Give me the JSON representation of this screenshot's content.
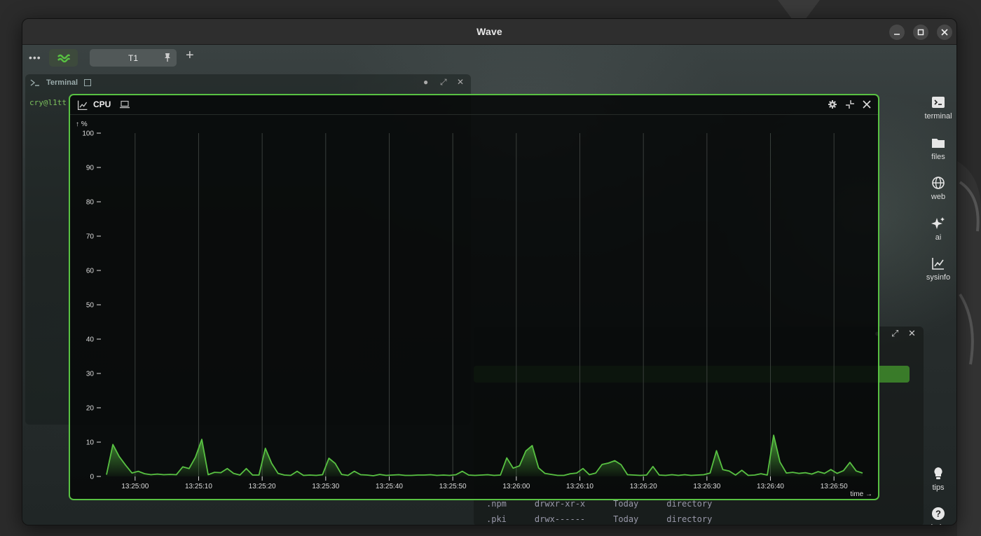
{
  "window": {
    "title": "Wave"
  },
  "tabbar": {
    "dots": "•••",
    "tab_label": "T1",
    "add": "+"
  },
  "terminal_block": {
    "title": "Terminal",
    "prompt_text": "cry@l1tt"
  },
  "sidebar": {
    "items": [
      {
        "label": "terminal",
        "icon": "terminal-icon"
      },
      {
        "label": "files",
        "icon": "folder-icon"
      },
      {
        "label": "web",
        "icon": "globe-icon"
      },
      {
        "label": "ai",
        "icon": "sparkles-icon"
      },
      {
        "label": "sysinfo",
        "icon": "chart-line-icon"
      },
      {
        "label": "tips",
        "icon": "lightbulb-icon"
      },
      {
        "label": "help",
        "icon": "help-icon"
      }
    ]
  },
  "files_block": {
    "rows": [
      {
        "name": ".npm",
        "mode": "drwxr-xr-x",
        "date": "Today",
        "type": "directory"
      },
      {
        "name": ".pki",
        "mode": "drwx------",
        "date": "Today",
        "type": "directory"
      }
    ]
  },
  "cpu_block": {
    "title": "CPU",
    "accent": "#58c142"
  },
  "chart_data": {
    "type": "area",
    "ylabel": "↑ %",
    "xlabel": "time →",
    "ylim": [
      0,
      100
    ],
    "yticks": [
      0,
      10,
      20,
      30,
      40,
      50,
      60,
      70,
      80,
      90,
      100
    ],
    "xtick_labels": [
      "13:25:00",
      "13:25:10",
      "13:25:20",
      "13:25:30",
      "13:25:40",
      "13:25:50",
      "13:26:00",
      "13:26:10",
      "13:26:20",
      "13:26:30",
      "13:26:40",
      "13:26:50"
    ],
    "x_start_sec": -4.5,
    "x_step_sec": 1,
    "grid": "vertical",
    "series": [
      {
        "color": "#58c142",
        "values": [
          0.5,
          9.3,
          5.8,
          3.3,
          1,
          1.5,
          0.8,
          0.5,
          0.7,
          0.5,
          0.6,
          0.5,
          2.8,
          2.3,
          5.6,
          10.8,
          0.5,
          1.2,
          1.1,
          2.3,
          0.9,
          0.4,
          2.3,
          0.4,
          0.4,
          8.2,
          3.8,
          0.9,
          0.4,
          0.3,
          1.5,
          0.3,
          0.4,
          0.3,
          0.5,
          5.3,
          3.8,
          0.6,
          0.3,
          1.5,
          0.5,
          0.4,
          0.2,
          0.6,
          0.3,
          0.4,
          0.5,
          0.3,
          0.3,
          0.4,
          0.4,
          0.5,
          0.3,
          0.4,
          0.3,
          0.5,
          1.5,
          0.4,
          0.3,
          0.4,
          0.5,
          0.3,
          0.4,
          5.4,
          2.4,
          3.1,
          7.4,
          9,
          2.5,
          0.9,
          0.6,
          0.3,
          0.3,
          0.8,
          1,
          2.3,
          0.5,
          1,
          3.5,
          3.9,
          4.6,
          3.4,
          0.5,
          0.4,
          0.3,
          0.4,
          2.9,
          0.4,
          0.3,
          0.5,
          0.3,
          0.5,
          0.3,
          0.4,
          0.5,
          1,
          7.5,
          2,
          1.6,
          0.4,
          1.8,
          0.3,
          0.4,
          0.8,
          0.4,
          12,
          4.2,
          1,
          1.2,
          0.9,
          1.1,
          0.7,
          1.4,
          0.9,
          2,
          0.9,
          1.7,
          4.1,
          1.6,
          1
        ]
      }
    ]
  }
}
